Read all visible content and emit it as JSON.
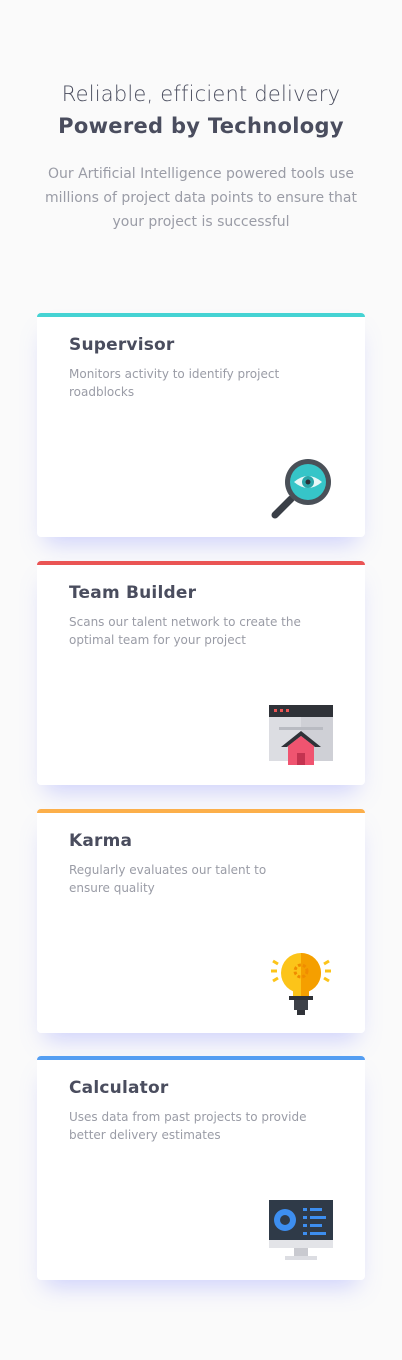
{
  "header": {
    "tagline": "Reliable, efficient delivery",
    "title": "Powered by Technology",
    "intro": "Our Artificial Intelligence powered tools use millions of project data points to ensure that your project is successful"
  },
  "cards": [
    {
      "title": "Supervisor",
      "description": "Monitors activity to identify project roadblocks",
      "accent_color": "#45d3d3",
      "icon": "magnifier-eye-icon"
    },
    {
      "title": "Team Builder",
      "description": "Scans our talent network to create the optimal team for your project",
      "accent_color": "#ea5454",
      "icon": "browser-house-icon"
    },
    {
      "title": "Karma",
      "description": "Regularly evaluates our talent to ensure quality",
      "accent_color": "#fcaf4a",
      "icon": "lightbulb-icon"
    },
    {
      "title": "Calculator",
      "description": "Uses data from past projects to provide better delivery estimates",
      "accent_color": "#549ef2",
      "icon": "monitor-dashboard-icon"
    }
  ]
}
